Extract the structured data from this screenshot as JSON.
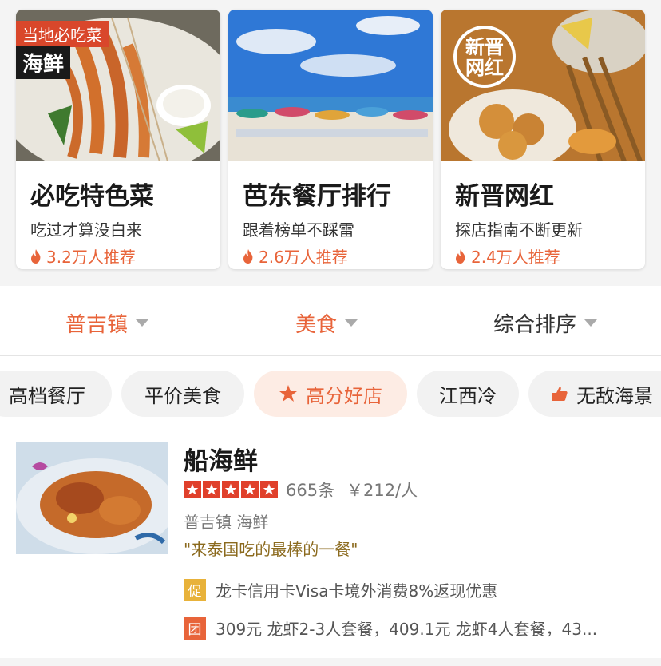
{
  "cards": [
    {
      "title": "必吃特色菜",
      "subtitle": "吃过才算没白来",
      "recommend": "3.2万人推荐",
      "tag_local": "当地必吃菜",
      "tag_kind": "海鲜"
    },
    {
      "title": "芭东餐厅排行",
      "subtitle": "跟着榜单不踩雷",
      "recommend": "2.6万人推荐"
    },
    {
      "title": "新晋网红",
      "subtitle": "探店指南不断更新",
      "recommend": "2.4万人推荐",
      "stamp_line1": "新晋",
      "stamp_line2": "网红"
    }
  ],
  "filters": [
    {
      "label": "普吉镇",
      "active": true
    },
    {
      "label": "美食",
      "active": true
    },
    {
      "label": "综合排序",
      "active": false
    }
  ],
  "chips": [
    "高档餐厅",
    "平价美食",
    "高分好店",
    "江西冷",
    "无敌海景"
  ],
  "listing": {
    "name": "船海鲜",
    "rating": 5,
    "reviews": "665条",
    "price": "￥212/人",
    "area": "普吉镇  海鲜",
    "quote": "\"来泰国吃的最棒的一餐\"",
    "promos": [
      {
        "badge": "促",
        "text": "龙卡信用卡Visa卡境外消费8%返现优惠"
      },
      {
        "badge": "团",
        "text": "309元 龙虾2-3人套餐，409.1元 龙虾4人套餐，43..."
      }
    ]
  },
  "colors": {
    "accent": "#e8643a",
    "star": "#e0402b",
    "promo_badge": "#e8b23a",
    "quote": "#8b6a1e"
  }
}
